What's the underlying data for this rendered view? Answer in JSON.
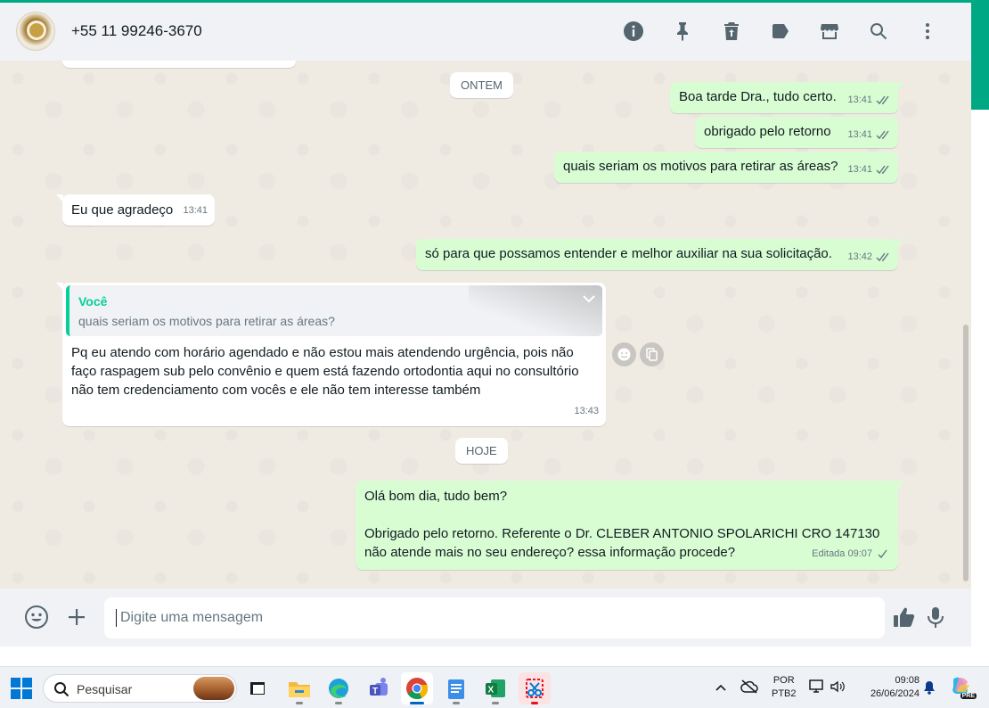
{
  "header": {
    "contact_name": "+55 11 99246-3670",
    "icons": [
      "info-icon",
      "pin-icon",
      "delete-icon",
      "label-icon",
      "store-icon",
      "search-icon",
      "menu-icon"
    ]
  },
  "chat": {
    "date_yesterday": "ONTEM",
    "date_today": "HOJE",
    "messages": [
      {
        "text": "Boa tarde Dra., tudo certo.",
        "time": "13:41"
      },
      {
        "text": "obrigado pelo retorno",
        "time": "13:41"
      },
      {
        "text": "quais seriam os motivos para retirar as áreas?",
        "time": "13:41"
      },
      {
        "text": "Eu que agradeço",
        "time": "13:41"
      },
      {
        "text": "só para que possamos entender e melhor auxiliar na sua solicitação.",
        "time": "13:42"
      },
      {
        "quote_author": "Você",
        "quote_text": "quais seriam os motivos para retirar as áreas?",
        "text": "Pq eu atendo com horário agendado e não estou mais atendendo urgência, pois não faço raspagem sub pelo convênio e quem está fazendo ortodontia aqui no consultório não tem credenciamento com vocês e ele não tem interesse também",
        "time": "13:43"
      },
      {
        "line1": "Olá bom dia, tudo bem?",
        "line2": "Obrigado pelo retorno. Referente o Dr. CLEBER ANTONIO SPOLARICHI CRO 147130 não atende mais no seu endereço? essa informação procede?",
        "time": "Editada 09:07"
      }
    ]
  },
  "composer": {
    "placeholder": "Digite uma mensagem"
  },
  "taskbar": {
    "search_label": "Pesquisar",
    "language": "POR",
    "layout": "PTB2",
    "time": "09:08",
    "date": "26/06/2024",
    "copilot_badge": "PRE"
  },
  "colors": {
    "accent": "#00a884",
    "outgoing_bubble": "#d9fdd3",
    "incoming_bubble": "#ffffff",
    "chat_background": "#efeae2",
    "quote_author": "#06cf9c",
    "read_ticks": "#667781"
  }
}
